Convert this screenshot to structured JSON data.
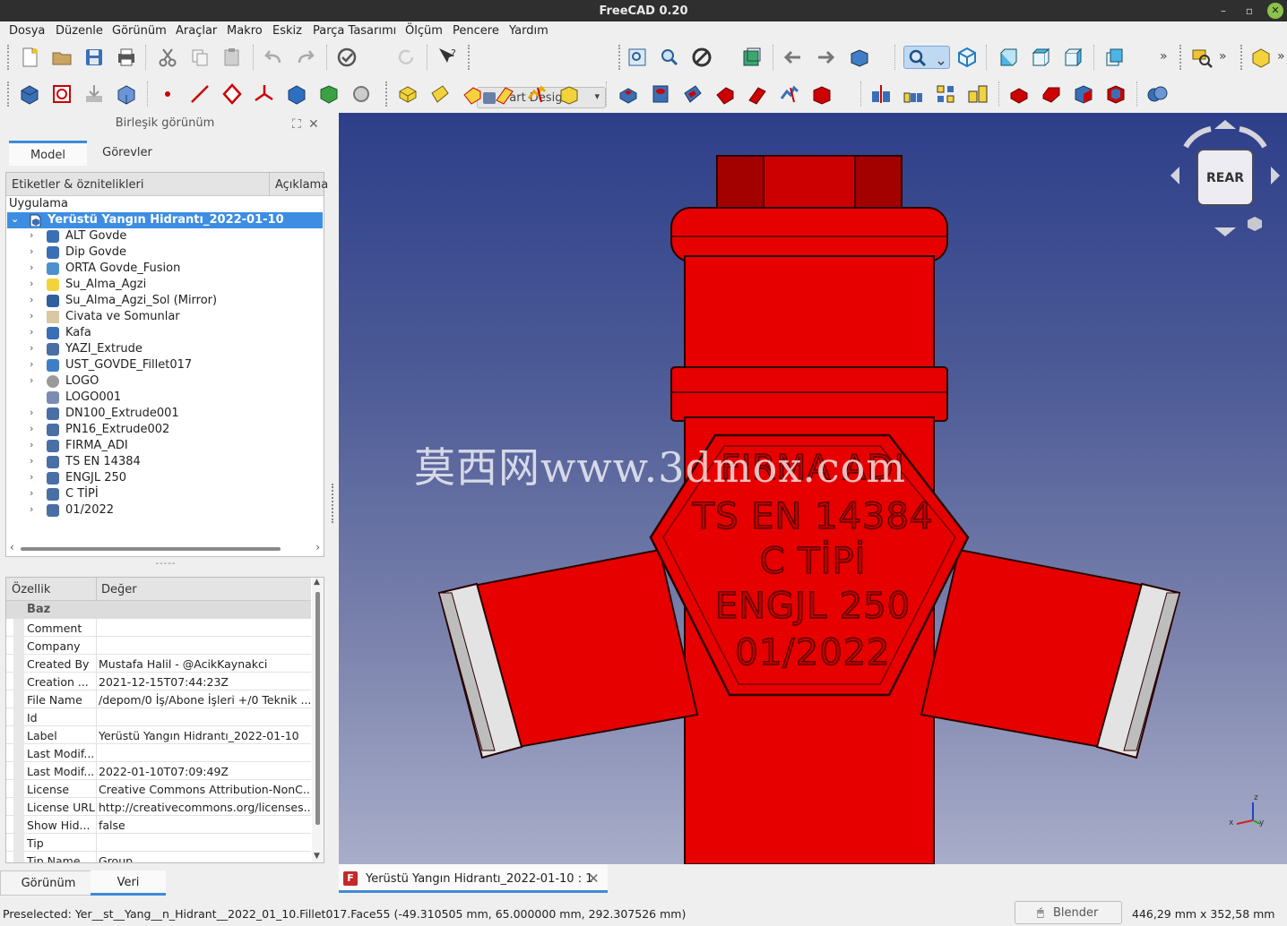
{
  "window": {
    "title": "FreeCAD 0.20"
  },
  "menu": [
    "Dosya",
    "Düzenle",
    "Görünüm",
    "Araçlar",
    "Makro",
    "Eskiz",
    "Parça Tasarımı",
    "Ölçüm",
    "Pencere",
    "Yardım"
  ],
  "toolbar": {
    "workbench": "Part Design",
    "overflow": "»"
  },
  "combo_view": {
    "title": "Birleşik görünüm",
    "tabs": [
      "Model",
      "Görevler"
    ],
    "tree_headers": [
      "Etiketler & öznitelikleri",
      "Açıklama"
    ],
    "app_heading": "Uygulama",
    "root": "Yerüstü Yangın Hidrantı_2022-01-10",
    "items": [
      {
        "label": "ALT Govde",
        "icon": "body-icon"
      },
      {
        "label": "Dip Govde",
        "icon": "body-icon"
      },
      {
        "label": "ORTA Govde_Fusion",
        "icon": "fusion-icon"
      },
      {
        "label": "Su_Alma_Agzi",
        "icon": "part-icon"
      },
      {
        "label": "Su_Alma_Agzi_Sol (Mirror)",
        "icon": "mirror-icon"
      },
      {
        "label": "Civata ve Somunlar",
        "icon": "folder-icon"
      },
      {
        "label": "Kafa",
        "icon": "body-icon"
      },
      {
        "label": "YAZI_Extrude",
        "icon": "extrude-icon"
      },
      {
        "label": "UST_GOVDE_Fillet017",
        "icon": "fillet-icon"
      },
      {
        "label": "LOGO",
        "icon": "shape-icon"
      },
      {
        "label": "LOGO001",
        "icon": "shapebinder-icon"
      },
      {
        "label": "DN100_Extrude001",
        "icon": "extrude-icon"
      },
      {
        "label": "PN16_Extrude002",
        "icon": "extrude-icon"
      },
      {
        "label": "FIRMA_ADI",
        "icon": "extrude-icon"
      },
      {
        "label": "TS EN 14384",
        "icon": "extrude-icon"
      },
      {
        "label": "ENGJL 250",
        "icon": "extrude-icon"
      },
      {
        "label": "C TİPİ",
        "icon": "extrude-icon"
      },
      {
        "label": "01/2022",
        "icon": "extrude-icon"
      }
    ],
    "splitter": "-----",
    "prop_headers": [
      "Özellik",
      "Değer"
    ],
    "prop_group": "Baz",
    "properties": [
      {
        "k": "Comment",
        "v": ""
      },
      {
        "k": "Company",
        "v": ""
      },
      {
        "k": "Created By",
        "v": "Mustafa Halil - @AcikKaynakci"
      },
      {
        "k": "Creation ...",
        "v": "2021-12-15T07:44:23Z"
      },
      {
        "k": "File Name",
        "v": "/depom/0 İş/Abone İşleri +/0 Teknik ..."
      },
      {
        "k": "Id",
        "v": ""
      },
      {
        "k": "Label",
        "v": "Yerüstü Yangın Hidrantı_2022-01-10"
      },
      {
        "k": "Last Modif...",
        "v": ""
      },
      {
        "k": "Last Modif...",
        "v": "2022-01-10T07:09:49Z"
      },
      {
        "k": "License",
        "v": "Creative Commons Attribution-NonC..."
      },
      {
        "k": "License URL",
        "v": "http://creativecommons.org/licenses..."
      },
      {
        "k": "Show Hid...",
        "v": "false"
      },
      {
        "k": "Tip",
        "v": ""
      },
      {
        "k": "Tip Name",
        "v": "Group"
      }
    ],
    "bottom_tabs": [
      "Görünüm",
      "Veri"
    ]
  },
  "viewport": {
    "watermark": "莫西网www.3dmox.com",
    "plate_text": [
      "FIRMA ADI",
      "TS EN 14384",
      "C TİPİ",
      "ENGJL 250",
      "01/2022"
    ],
    "navcube_face": "REAR",
    "axis": {
      "x": "x",
      "y": "y",
      "z": "z"
    }
  },
  "document_tab": "Yerüstü Yangın Hidrantı_2022-01-10 : 1",
  "status": {
    "preselected": "Preselected: Yer__st__Yang__n_Hidrant__2022_01_10.Fillet017.Face55 (-49.310505 mm, 65.000000 mm, 292.307526 mm)",
    "nav_style": "Blender",
    "dimensions": "446,29 mm x 352,58 mm"
  },
  "colors": {
    "accent": "#3d8bd8",
    "selection": "#3d8ee3",
    "hydrant": "#e10000",
    "hydrant_dark": "#9c0000"
  }
}
